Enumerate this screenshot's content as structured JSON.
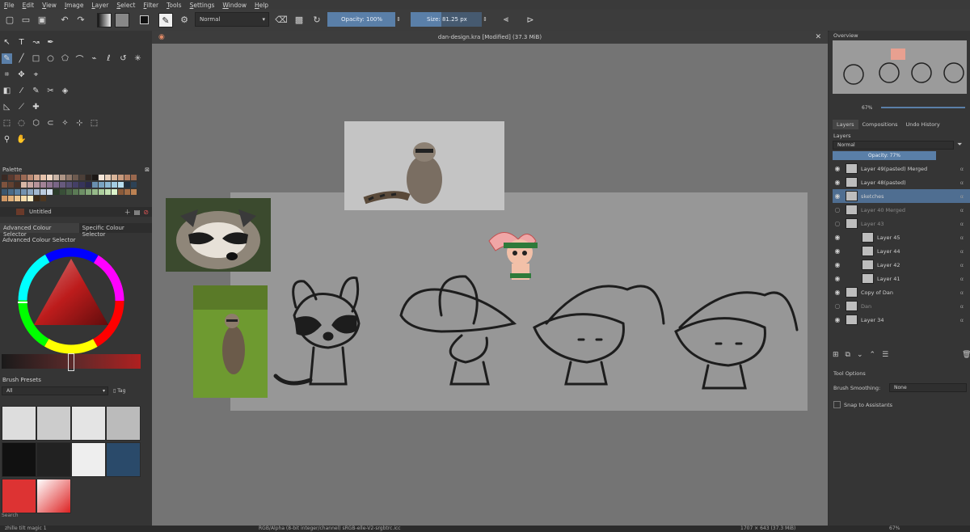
{
  "menu": [
    "File",
    "Edit",
    "View",
    "Image",
    "Layer",
    "Select",
    "Filter",
    "Tools",
    "Settings",
    "Window",
    "Help"
  ],
  "toolbar": {
    "blend_mode": "Normal",
    "opacity_label": "Opacity:",
    "opacity_value": "100%",
    "size_label": "Size:",
    "size_value": "81.25 px"
  },
  "canvas": {
    "title": "dan-design.kra [Modified]  (37.3 MiB)"
  },
  "palette": {
    "title": "Palette",
    "name": "Untitled",
    "colors": [
      "#3a2a24",
      "#5b3a2f",
      "#7a4d3c",
      "#9b6a55",
      "#b98a73",
      "#d3a891",
      "#e5c1aa",
      "#f0d7c4",
      "#c9b4a6",
      "#ae9586",
      "#8e776a",
      "#6d5a4f",
      "#4c3f38",
      "#2e2622",
      "#1c1816",
      "#f5e6d8",
      "#e8d0bb",
      "#d9b59a",
      "#c89a7d",
      "#b47f62",
      "#9a684e",
      "#7e533e",
      "#624131",
      "#473026",
      "#d7b7a5",
      "#c8a6a0",
      "#b6939a",
      "#a28296",
      "#8e738f",
      "#7a6687",
      "#675a7d",
      "#554e72",
      "#443f66",
      "#36345a",
      "#2a2a4d",
      "#6a8fb0",
      "#7aa3c1",
      "#8db7d2",
      "#a2cbe2",
      "#b7ddef",
      "#203040",
      "#2d4256",
      "#3b566e",
      "#4a6b87",
      "#5b80a0",
      "#7392b0",
      "#8ba5c0",
      "#a3b8cf",
      "#bbccdf",
      "#d3e0ee",
      "#2a3b2a",
      "#394f38",
      "#4a6446",
      "#5b7a55",
      "#6e9066",
      "#82a677",
      "#97bb8a",
      "#adcf9e",
      "#c4e2b4",
      "#dbf3cb",
      "#8a5a3a",
      "#a36d46",
      "#bc8253",
      "#d09865",
      "#e0af79",
      "#edc690",
      "#f6dba9",
      "#fcecc4",
      "#3c2a18",
      "#4e3720"
    ]
  },
  "color_selector": {
    "tab1": "Advanced Colour Selector",
    "tab2": "Specific Colour Selector",
    "title": "Advanced Colour Selector"
  },
  "brush_presets": {
    "title": "Brush Presets",
    "filter": "All",
    "tag": "Tag",
    "search_placeholder": "Search"
  },
  "overview": {
    "title": "Overview",
    "zoom": "67%"
  },
  "layers_panel": {
    "tabs": [
      "Layers",
      "Compositions",
      "Undo History"
    ],
    "title": "Layers",
    "blend": "Normal",
    "opacity": "Opacity:  77%",
    "items": [
      {
        "name": "Layer 49(pasted) Merged",
        "visible": true,
        "selected": false,
        "indent": 0
      },
      {
        "name": "Layer 48(pasted)",
        "visible": true,
        "selected": false,
        "indent": 0
      },
      {
        "name": "sketches",
        "visible": true,
        "selected": true,
        "indent": 0
      },
      {
        "name": "Layer 40 Merged",
        "visible": false,
        "selected": false,
        "indent": 0
      },
      {
        "name": "Layer 43",
        "visible": false,
        "selected": false,
        "indent": 0
      },
      {
        "name": "Layer 45",
        "visible": true,
        "selected": false,
        "indent": 1
      },
      {
        "name": "Layer 44",
        "visible": true,
        "selected": false,
        "indent": 1
      },
      {
        "name": "Layer 42",
        "visible": true,
        "selected": false,
        "indent": 1
      },
      {
        "name": "Layer 41",
        "visible": true,
        "selected": false,
        "indent": 1
      },
      {
        "name": "Copy of Dan",
        "visible": true,
        "selected": false,
        "indent": 0
      },
      {
        "name": "Dan",
        "visible": false,
        "selected": false,
        "indent": 0
      },
      {
        "name": "Layer 34",
        "visible": true,
        "selected": false,
        "indent": 0
      }
    ]
  },
  "tool_options": {
    "title": "Tool Options",
    "smoothing_label": "Brush Smoothing:",
    "smoothing_value": "None",
    "snap": "Snap to Assistants"
  },
  "status": {
    "left": "zhille tilt magic 1",
    "middle": "RGB/Alpha (8-bit integer/channel)  sRGB-elle-V2-srgbtrc.icc",
    "right": "1707 × 643 (37.3 MiB)",
    "zoom": "67%"
  }
}
